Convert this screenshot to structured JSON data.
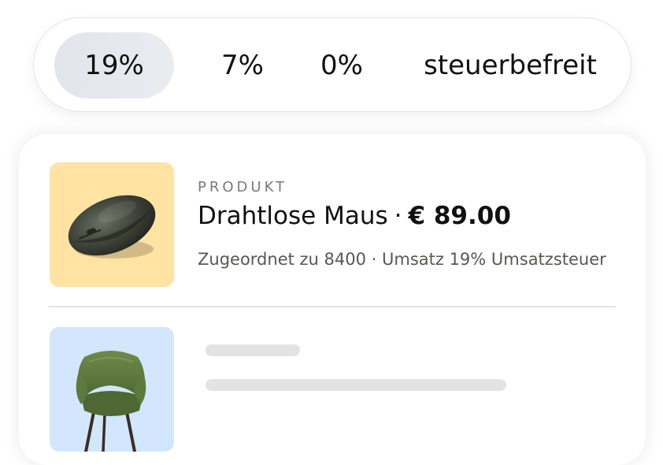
{
  "tax_rates": {
    "options": [
      "19%",
      "7%",
      "0%",
      "steuerbefreit"
    ],
    "selected": "19%"
  },
  "product": {
    "eyebrow": "PRODUKT",
    "name": "Drahtlose Maus",
    "separator": "·",
    "price": "€ 89.00",
    "assignment": "Zugeordnet zu 8400 · Umsatz 19% Umsatzsteuer",
    "image_icon": "computer-mouse-icon"
  },
  "next_product": {
    "image_icon": "armchair-icon"
  },
  "colors": {
    "selected_pill": "#e1e5ec",
    "mouse_tile": "#ffe3a3",
    "chair_tile": "#d2e6fd",
    "subline_text": "#555a4f"
  }
}
